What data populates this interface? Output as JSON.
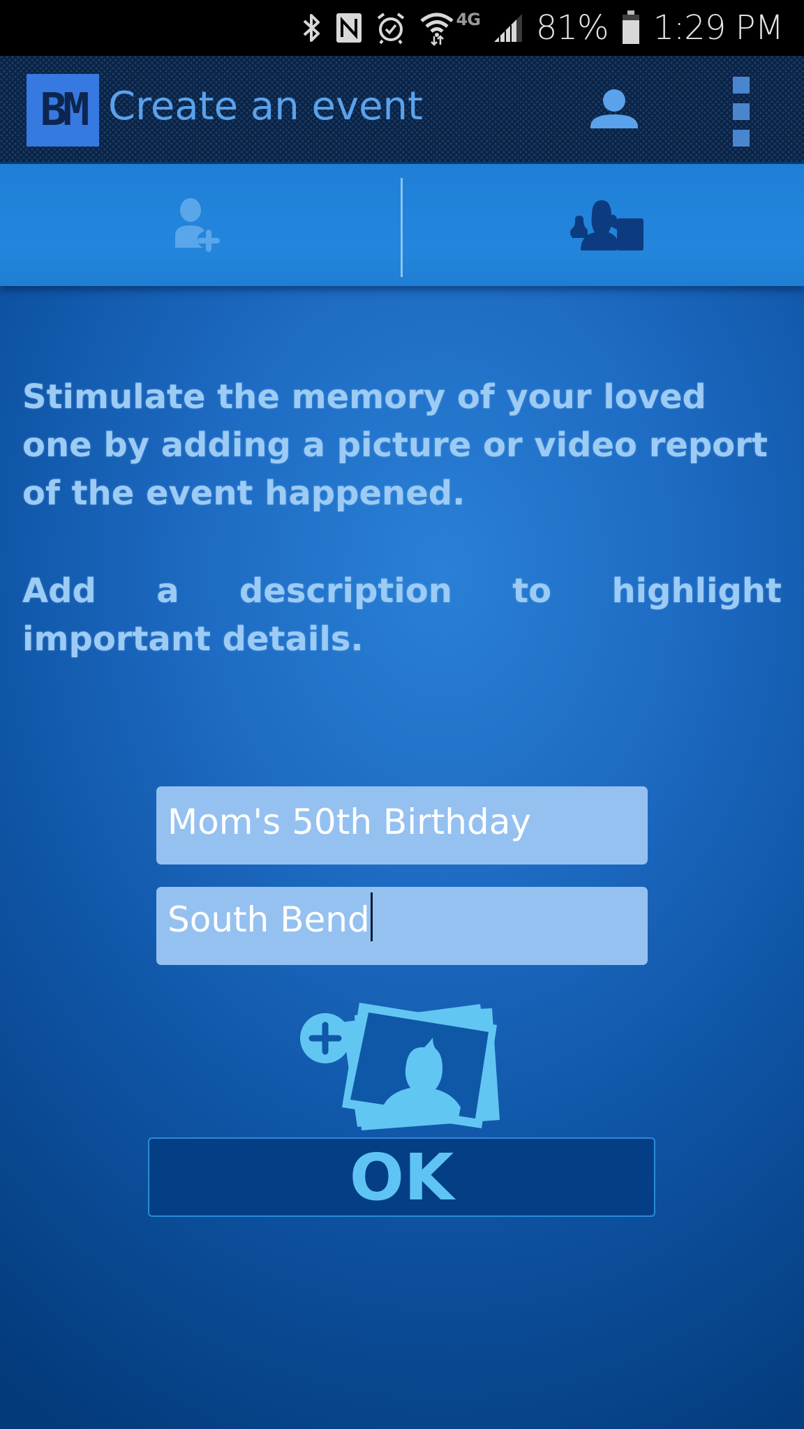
{
  "status_bar": {
    "icons": [
      "bluetooth-icon",
      "nfc-icon",
      "alarm-icon",
      "wifi-icon",
      "4g-lte-icon",
      "signal-icon",
      "battery-icon"
    ],
    "network_label": "4G",
    "battery_percent": "81%",
    "time": "1:29 PM"
  },
  "app_bar": {
    "logo_text": "BM",
    "title": "Create an event",
    "profile_icon": "person-icon",
    "menu_icon": "overflow-menu-icon"
  },
  "tabs": [
    {
      "name": "add-person",
      "icon": "person-add-icon",
      "active": false
    },
    {
      "name": "group-event",
      "icon": "group-icon",
      "active": true
    }
  ],
  "content": {
    "paragraph1": "Stimulate the memory of your loved one by adding a picture or video report of the event happened.",
    "paragraph2": "Add a description to highlight important details."
  },
  "form": {
    "event_name_value": "Mom's 50th Birthday",
    "location_value": "South Bend",
    "add_media_icon": "add-photo-icon",
    "ok_label": "OK"
  },
  "colors": {
    "accent": "#5aa2ec",
    "ok_text": "#5fc4f4",
    "field_bg": "#95c1f1",
    "tab_active": "#0d3b80"
  }
}
